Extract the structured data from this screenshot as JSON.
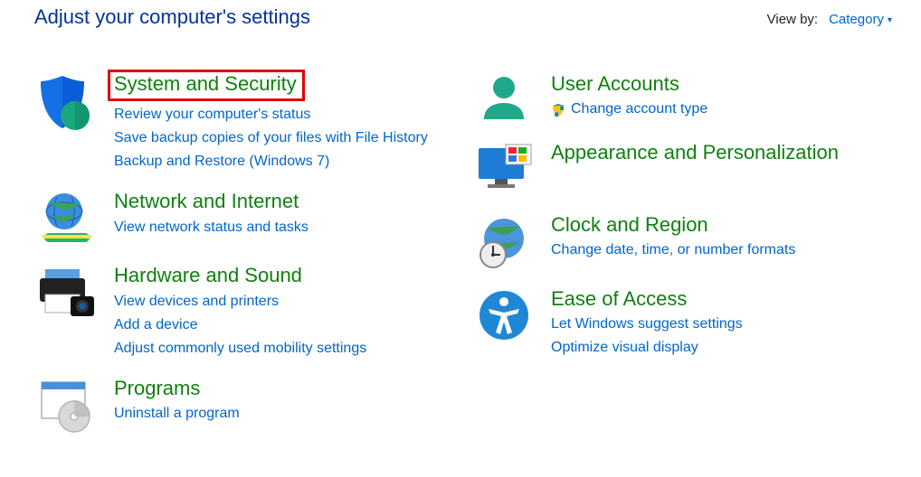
{
  "header": {
    "title": "Adjust your computer's settings",
    "view_by_label": "View by:",
    "view_by_value": "Category"
  },
  "left": [
    {
      "id": "system-security",
      "title": "System and Security",
      "highlighted": true,
      "links": [
        "Review your computer's status",
        "Save backup copies of your files with File History",
        "Backup and Restore (Windows 7)"
      ]
    },
    {
      "id": "network-internet",
      "title": "Network and Internet",
      "links": [
        "View network status and tasks"
      ]
    },
    {
      "id": "hardware-sound",
      "title": "Hardware and Sound",
      "links": [
        "View devices and printers",
        "Add a device",
        "Adjust commonly used mobility settings"
      ]
    },
    {
      "id": "programs",
      "title": "Programs",
      "links": [
        "Uninstall a program"
      ]
    }
  ],
  "right": [
    {
      "id": "user-accounts",
      "title": "User Accounts",
      "links": [
        {
          "text": "Change account type",
          "shield": true
        }
      ]
    },
    {
      "id": "appearance",
      "title": "Appearance and Personalization",
      "links": []
    },
    {
      "id": "clock-region",
      "title": "Clock and Region",
      "links": [
        "Change date, time, or number formats"
      ]
    },
    {
      "id": "ease-of-access",
      "title": "Ease of Access",
      "links": [
        "Let Windows suggest settings",
        "Optimize visual display"
      ]
    }
  ]
}
